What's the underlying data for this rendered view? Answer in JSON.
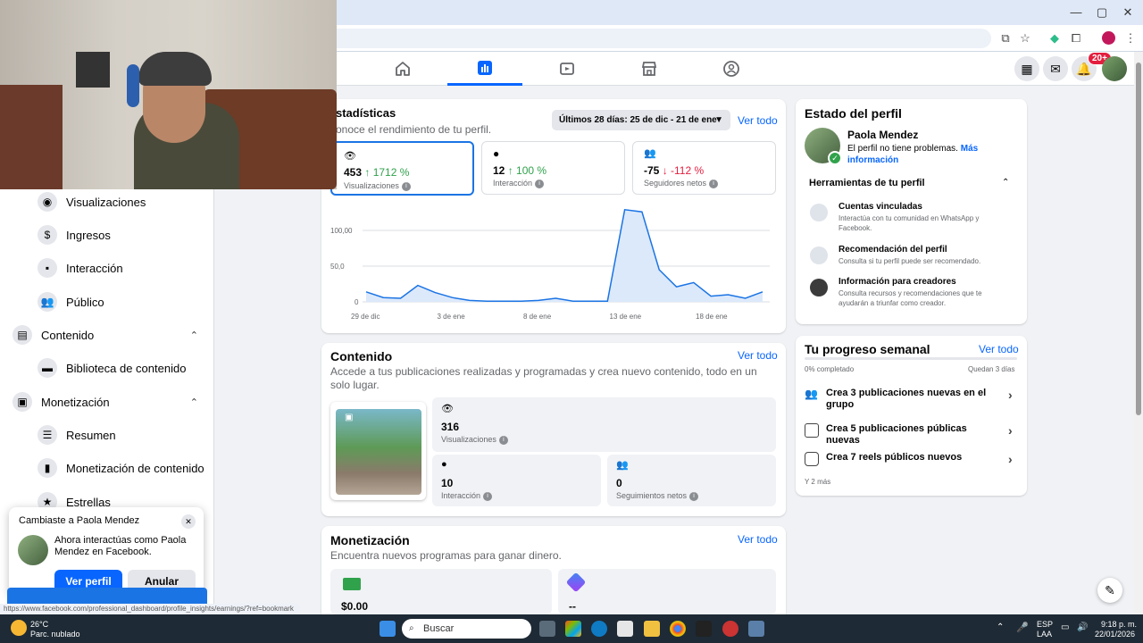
{
  "fb_nav": {
    "notifications_badge": "20+"
  },
  "sidebar": {
    "items": [
      {
        "label": "Visualizaciones",
        "icon": "eye-icon"
      },
      {
        "label": "Ingresos",
        "icon": "dollar-icon"
      },
      {
        "label": "Interacción",
        "icon": "chat-icon"
      },
      {
        "label": "Público",
        "icon": "people-icon"
      },
      {
        "label": "Contenido",
        "icon": "content-icon"
      },
      {
        "label": "Biblioteca de contenido",
        "icon": "library-icon"
      },
      {
        "label": "Monetización",
        "icon": "money-icon"
      },
      {
        "label": "Resumen",
        "icon": "list-icon"
      },
      {
        "label": "Monetización de contenido",
        "icon": "monetize-icon"
      },
      {
        "label": "Estrellas",
        "icon": "star-icon"
      }
    ]
  },
  "stats": {
    "title": "Estadísticas",
    "title_visible": "stadísticas",
    "subtitle": "onoce el rendimiento de tu perfil.",
    "date_range": "Últimos 28 días: 25 de dic - 21 de ene",
    "see_all": "Ver todo",
    "metrics": [
      {
        "value": "453",
        "delta": "↑ 1712 %",
        "label": "Visualizaciones"
      },
      {
        "value": "12",
        "delta": "↑ 100 %",
        "label": "Interacción"
      },
      {
        "value": "-75",
        "delta": "↓ -112 %",
        "label": "Seguidores netos"
      }
    ]
  },
  "chart_data": {
    "type": "area",
    "x_ticks": [
      "29 de dic",
      "3 de ene",
      "8 de ene",
      "13 de ene",
      "18 de ene"
    ],
    "y_ticks": [
      "100,00",
      "50,0",
      "0"
    ],
    "ylim": [
      0,
      125
    ],
    "values": [
      14,
      6,
      5,
      23,
      13,
      6,
      2,
      1,
      1,
      1,
      2,
      5,
      1,
      1,
      1,
      129,
      126,
      45,
      21,
      27,
      8,
      10,
      5,
      14
    ],
    "grid": true,
    "color": "#1b74e4"
  },
  "profile_state": {
    "title": "Estado del perfil",
    "name": "Paola Mendez",
    "status": "El perfil no tiene problemas.",
    "more": "Más información",
    "tools_title": "Herramientas de tu perfil",
    "tools": [
      {
        "title": "Cuentas vinculadas",
        "desc": "Interactúa con tu comunidad en WhatsApp y Facebook."
      },
      {
        "title": "Recomendación del perfil",
        "desc": "Consulta si tu perfil puede ser recomendado."
      },
      {
        "title": "Información para creadores",
        "desc": "Consulta recursos y recomendaciones que te ayudarán a triunfar como creador."
      }
    ]
  },
  "content": {
    "title": "Contenido",
    "see_all": "Ver todo",
    "desc": "Accede a tus publicaciones realizadas y programadas y crea nuevo contenido, todo en un solo lugar.",
    "views_value": "316",
    "views_label": "Visualizaciones",
    "interaction_value": "10",
    "interaction_label": "Interacción",
    "follows_value": "0",
    "follows_label": "Seguimientos netos"
  },
  "weekly": {
    "title": "Tu progreso semanal",
    "see_all": "Ver todo",
    "completed": "0% completado",
    "remaining": "Quedan 3 días",
    "progress": 0,
    "tasks": [
      {
        "label": "Crea 3 publicaciones nuevas en el grupo"
      },
      {
        "label": "Crea 5 publicaciones públicas nuevas"
      },
      {
        "label": "Crea 7 reels públicos nuevos"
      }
    ],
    "more": "Y 2 más"
  },
  "monetization": {
    "title": "Monetización",
    "see_all": "Ver todo",
    "desc": "Encuentra nuevos programas para ganar dinero.",
    "value1": "$0.00",
    "value2": "--"
  },
  "toast": {
    "title": "Cambiaste a Paola Mendez",
    "message": "Ahora interactúas como Paola Mendez en Facebook.",
    "primary": "Ver perfil",
    "secondary": "Anular"
  },
  "status_url": "https://www.facebook.com/professional_dashboard/profile_insights/earnings/?ref=bookmark",
  "taskbar": {
    "weather_temp": "26°C",
    "weather_desc": "Parc. nublado",
    "search_placeholder": "Buscar",
    "lang1": "ESP",
    "lang2": "LAA",
    "time": "9:18 p. m.",
    "date": "22/01/2026"
  }
}
